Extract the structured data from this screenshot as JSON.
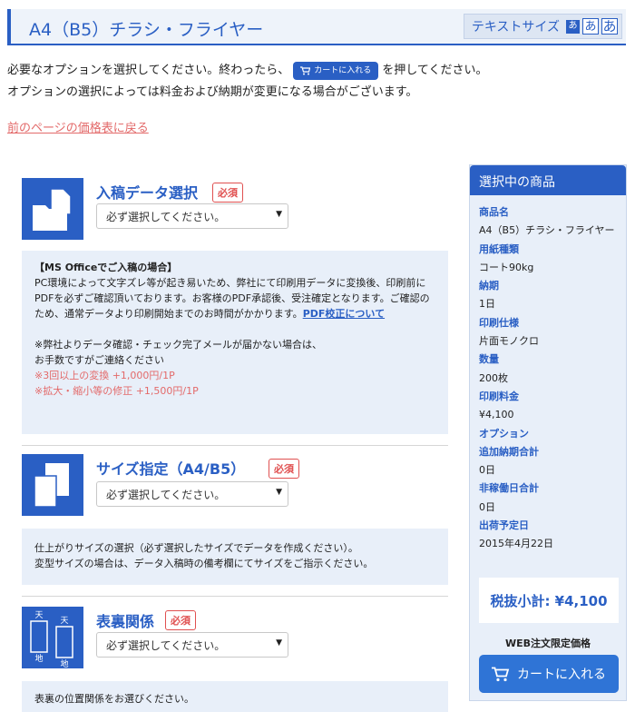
{
  "header": {
    "title": "A4（B5）チラシ・フライヤー",
    "text_size_label": "テキストサイズ",
    "size_small": "あ",
    "size_medium": "あ",
    "size_large": "あ"
  },
  "intro": {
    "line1_before": "必要なオプションを選択してください。終わったら、",
    "cart_button_label": "カートに入れる",
    "line1_after": "を押してください。",
    "line2": "オプションの選択によっては料金および納期が変更になる場合がございます。",
    "back_link": "前のページの価格表に戻る"
  },
  "sections": {
    "upload": {
      "title": "入稿データ選択",
      "required": "必須",
      "select_value": "必ず選択してください。",
      "note_heading": "【MS Officeでご入稿の場合】",
      "note_body": "PC環境によって文字ズレ等が起き易いため、弊社にて印刷用データに変換後、印刷前にPDFを必ずご確認頂いております。お客様のPDF承認後、受注確定となります。ご確認のため、通常データより印刷開始までのお時間がかかります。",
      "note_link": "PDF校正について",
      "note_mail_1": "※弊社よりデータ確認・チェック完了メールが届かない場合は、",
      "note_mail_2": "お手数ですがご連絡ください",
      "note_fee_1": "※3回以上の変換 +1,000円/1P",
      "note_fee_2": "※拡大・縮小等の修正 +1,500円/1P"
    },
    "size": {
      "title": "サイズ指定（A4/B5）",
      "required": "必須",
      "select_value": "必ず選択してください。",
      "note_1": "仕上がりサイズの選択（必ず選択したサイズでデータを作成ください）。",
      "note_2": "変型サイズの場合は、データ入稿時の備考欄にてサイズをご指示ください。"
    },
    "sides": {
      "title": "表裏関係",
      "required": "必須",
      "select_value": "必ず選択してください。",
      "icon_top": "天",
      "icon_bottom": "地",
      "note_1": "表裏の位置関係をお選びください。"
    }
  },
  "sidebar": {
    "title": "選択中の商品",
    "items": [
      {
        "label": "商品名",
        "value": "A4（B5）チラシ・フライヤー"
      },
      {
        "label": "用紙種類",
        "value": "コート90kg"
      },
      {
        "label": "納期",
        "value": "1日"
      },
      {
        "label": "印刷仕様",
        "value": "片面モノクロ"
      },
      {
        "label": "数量",
        "value": "200枚"
      },
      {
        "label": "印刷料金",
        "value": "¥4,100"
      },
      {
        "label": "オプション",
        "value": ""
      },
      {
        "label": "追加納期合計",
        "value": "0日"
      },
      {
        "label": "非稼働日合計",
        "value": "0日"
      },
      {
        "label": "出荷予定日",
        "value": "2015年4月22日"
      }
    ],
    "subtotal": "税抜小計: ¥4,100",
    "web_limited": "WEB注文限定価格",
    "cart_button": "カートに入れる"
  },
  "colors": {
    "accent": "#2a5fc4",
    "required": "#e05050",
    "note_bg": "#e8eff9",
    "link_red": "#e36a6a"
  }
}
